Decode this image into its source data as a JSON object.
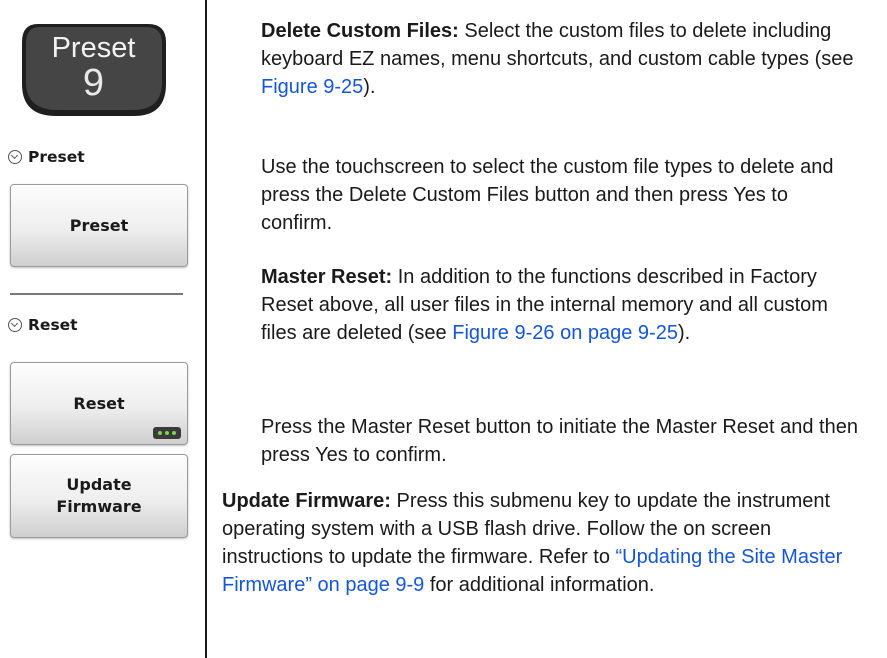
{
  "menu": {
    "hardkey": {
      "word": "Preset",
      "number": "9"
    },
    "preset_header": "Preset",
    "preset_button": "Preset",
    "reset_header": "Reset",
    "reset_button": "Reset",
    "update_firmware_button_line1": "Update",
    "update_firmware_button_line2": "Firmware"
  },
  "content": {
    "delete_custom": {
      "term": "Delete Custom Files:",
      "text": " Select the custom files to delete including keyboard EZ names, menu shortcuts, and custom cable types (see ",
      "link": "Figure 9-25",
      "end": ")."
    },
    "delete_custom_instr": "Use the touchscreen to select the custom file types to delete and press the Delete Custom Files button and then press Yes to confirm.",
    "master_reset": {
      "term": "Master Reset:",
      "text": " In addition to the functions described in Factory Reset above, all user files in the internal memory and all custom files are deleted (see ",
      "link": "Figure 9-26 on page 9-25",
      "end": ")."
    },
    "master_reset_instr": "Press the Master Reset button to initiate the Master Reset and then press Yes to confirm.",
    "update_firmware": {
      "term": "Update Firmware:",
      "text": "  Press this submenu key to update the instrument operating system with a USB flash drive. Follow the on screen instructions to update the firmware. Refer to ",
      "link": "“Updating the Site Master Firmware” on page 9-9",
      "end": " for additional information."
    }
  },
  "colors": {
    "link": "#1556d6",
    "key_face": "#3c3c3c",
    "more_dots": "#7bd64a"
  }
}
